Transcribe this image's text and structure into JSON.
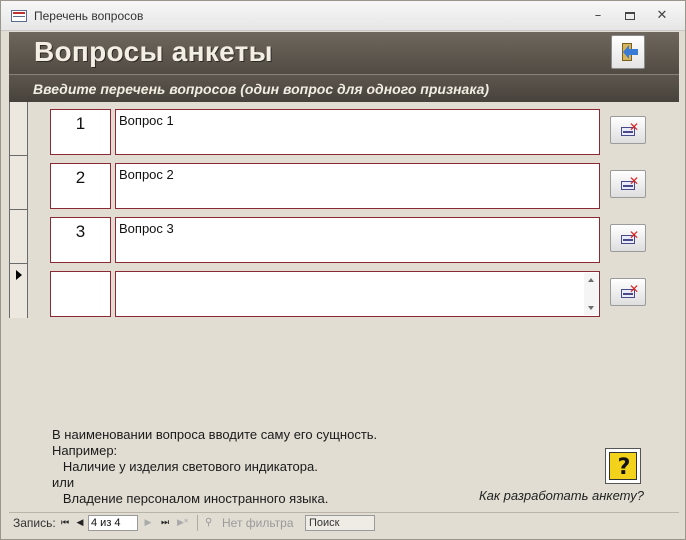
{
  "window": {
    "title": "Перечень вопросов",
    "minimize": "–",
    "close": "✕"
  },
  "header": {
    "title": "Вопросы анкеты",
    "subtitle": "Введите перечень вопросов (один вопрос для одного признака)",
    "exit_icon": "exit-door-icon"
  },
  "rows": [
    {
      "number": "1",
      "question": "Вопрос 1"
    },
    {
      "number": "2",
      "question": "Вопрос 2"
    },
    {
      "number": "3",
      "question": "Вопрос 3"
    },
    {
      "number": "",
      "question": ""
    }
  ],
  "delete_icon": "delete-record-icon",
  "hint": {
    "text": "В наименовании вопроса вводите саму его сущность.\nНапример:\n   Наличие у изделия светового индикатора.\nили\n   Владение персоналом иностранного языка."
  },
  "help": {
    "icon": "help-question-icon",
    "symbol": "?",
    "link": "Как разработать анкету?"
  },
  "navigation": {
    "label": "Запись:",
    "record": "4 из 4",
    "filter": "Нет фильтра",
    "search": "Поиск",
    "first": "⏮",
    "prev": "◀",
    "next": "▶",
    "last": "⏭",
    "new": "▶*"
  },
  "colors": {
    "accent_border": "#8b2a35",
    "header_bg": "#5f5950",
    "form_bg": "#e1ddd2"
  }
}
